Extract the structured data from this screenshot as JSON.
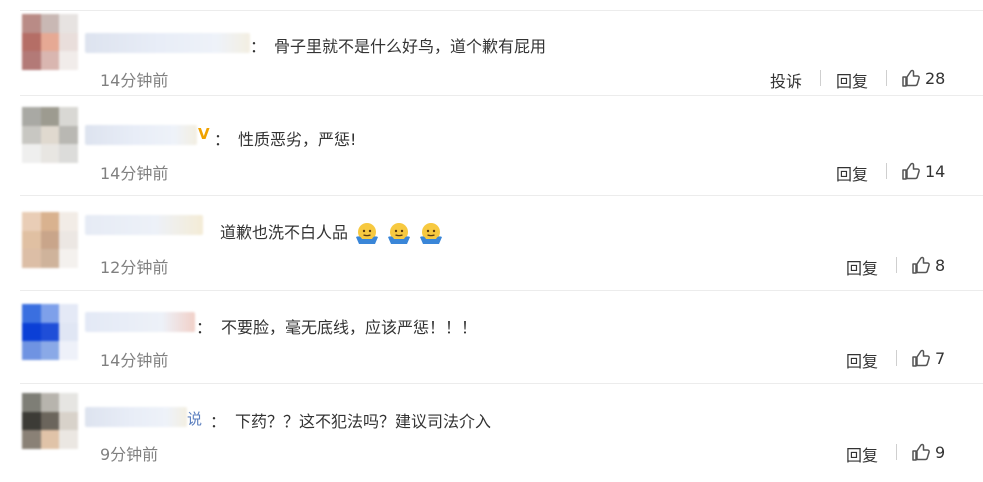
{
  "comments": [
    {
      "text": "骨子里就不是什么好鸟，道个歉有屁用",
      "time": "14分钟前",
      "report": "投诉",
      "reply": "回复",
      "likes": "28",
      "name_tail": ""
    },
    {
      "text": "性质恶劣，严惩!",
      "time": "14分钟前",
      "reply": "回复",
      "likes": "14",
      "name_tail": "V"
    },
    {
      "text": "道歉也洗不白人品",
      "time": "12分钟前",
      "reply": "回复",
      "likes": "8",
      "emoji_icons": [
        "shrug-emoji-icon",
        "shrug-emoji-icon",
        "shrug-emoji-icon"
      ]
    },
    {
      "text": "不要脸，毫无底线，应该严惩！！！",
      "time": "14分钟前",
      "reply": "回复",
      "likes": "7"
    },
    {
      "text": "下药？？这不犯法吗？建议司法介入",
      "time": "9分钟前",
      "reply": "回复",
      "likes": "9",
      "name_tail": "说"
    }
  ],
  "colon": "：",
  "icons": {
    "like": "thumbs-up-icon"
  },
  "colors": {
    "text": "#333333",
    "meta": "#808080",
    "separator": "#ececec"
  }
}
